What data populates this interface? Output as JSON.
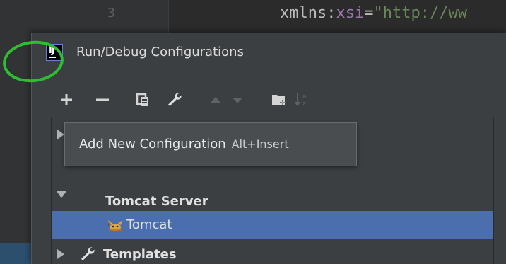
{
  "editor": {
    "line_number": "3",
    "code_ns": "xmlns:",
    "code_attr": "xsi",
    "code_eq": "=",
    "code_value": "\"http://ww"
  },
  "dialog": {
    "title": "Run/Debug Configurations",
    "logo_letters": "IJ"
  },
  "toolbar": {
    "add_label": "+",
    "remove_label": "–",
    "sort_label": "↓a₂"
  },
  "tooltip": {
    "text": "Add New Configuration",
    "shortcut": "Alt+Insert"
  },
  "tree": {
    "tomcat_server_label": "Tomcat Server",
    "tomcat_label": "Tomcat",
    "templates_label": "Templates"
  },
  "colors": {
    "highlight_circle": "#2dbe32",
    "selection": "#4b6eaf",
    "dialog_bg": "#3c3f41"
  }
}
